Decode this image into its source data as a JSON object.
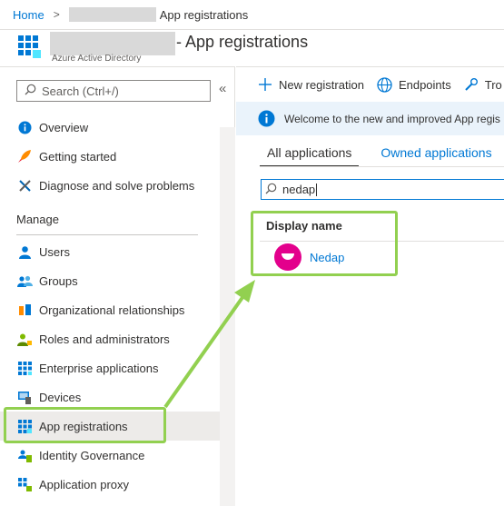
{
  "breadcrumb": {
    "home": "Home",
    "current": "App registrations"
  },
  "header": {
    "title": "- App registrations",
    "subtitle": "Azure Active Directory"
  },
  "sidebar": {
    "search_placeholder": "Search (Ctrl+/)",
    "collapse": "«",
    "items": [
      {
        "label": "Overview",
        "icon": "info-icon"
      },
      {
        "label": "Getting started",
        "icon": "rocket-icon"
      },
      {
        "label": "Diagnose and solve problems",
        "icon": "wrench-icon"
      }
    ],
    "section_title": "Manage",
    "manage_items": [
      {
        "label": "Users",
        "icon": "user-icon"
      },
      {
        "label": "Groups",
        "icon": "group-icon"
      },
      {
        "label": "Organizational relationships",
        "icon": "org-icon"
      },
      {
        "label": "Roles and administrators",
        "icon": "roles-icon"
      },
      {
        "label": "Enterprise applications",
        "icon": "enterprise-apps-icon"
      },
      {
        "label": "Devices",
        "icon": "device-icon"
      },
      {
        "label": "App registrations",
        "icon": "app-registrations-icon",
        "active": true
      },
      {
        "label": "Identity Governance",
        "icon": "governance-icon"
      },
      {
        "label": "Application proxy",
        "icon": "proxy-icon"
      }
    ]
  },
  "toolbar": {
    "new_registration": "New registration",
    "endpoints": "Endpoints",
    "troubleshooting": "Tro"
  },
  "banner": {
    "text": "Welcome to the new and improved App regis"
  },
  "tabs": {
    "all": "All applications",
    "owned": "Owned applications"
  },
  "filter": {
    "value": "nedap"
  },
  "table": {
    "column": "Display name",
    "rows": [
      {
        "name": "Nedap"
      }
    ]
  },
  "colors": {
    "accent": "#0078d4",
    "highlight": "#92d050",
    "avatar": "#e3008c"
  }
}
